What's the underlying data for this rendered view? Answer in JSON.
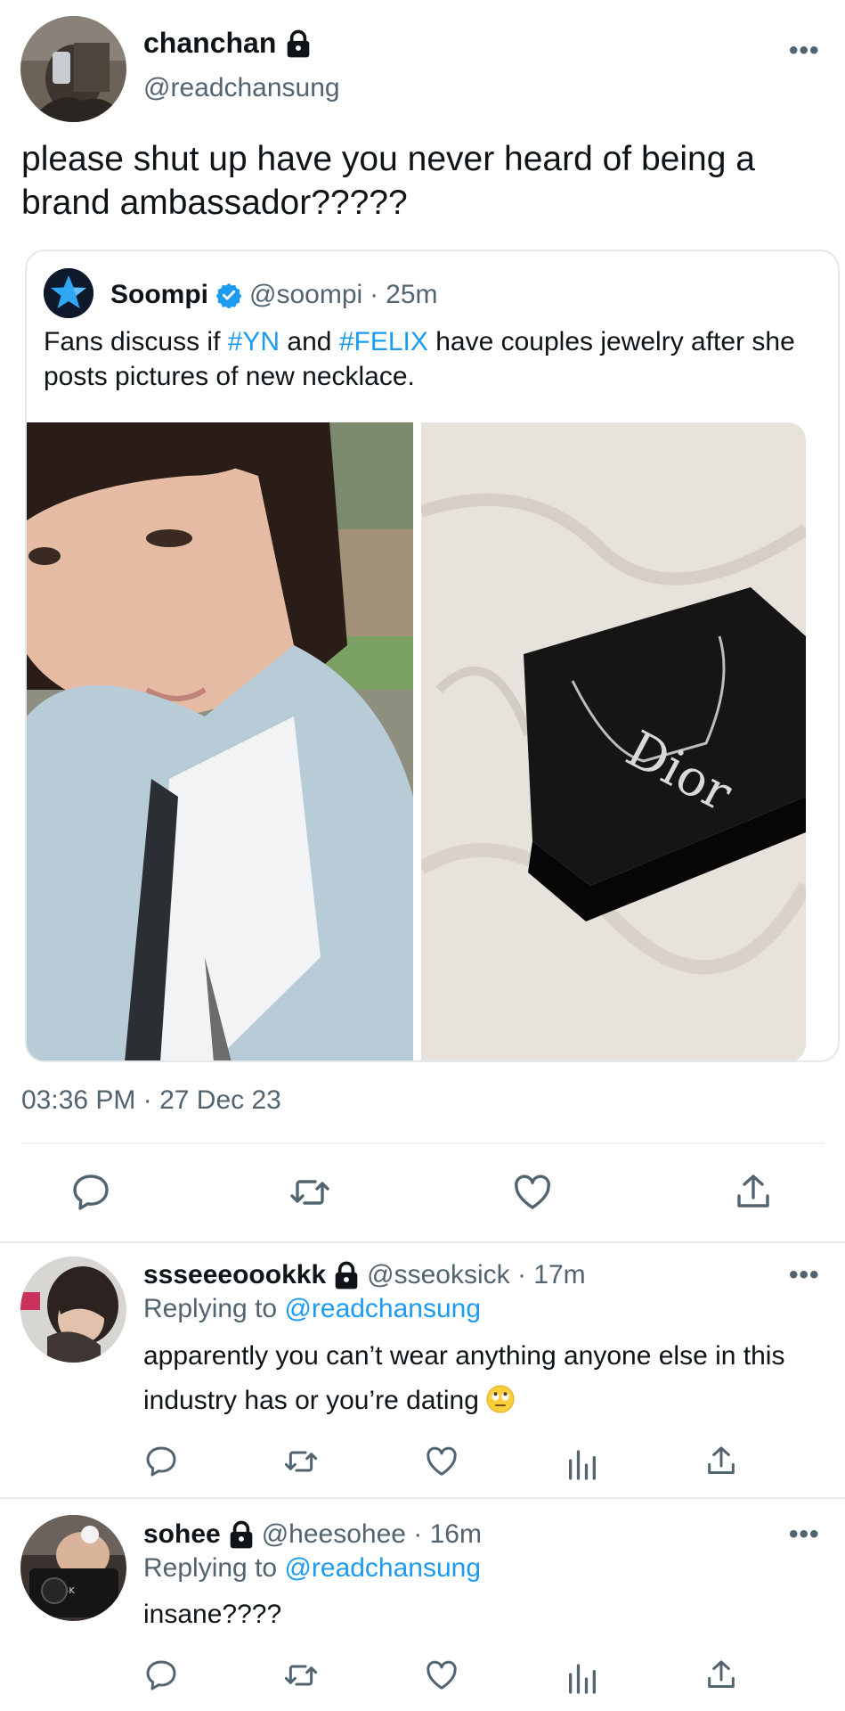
{
  "main_tweet": {
    "author_name": "chanchan",
    "author_handle": "@readchansung",
    "text": "please shut up have you never heard of being a brand ambassador?????",
    "timestamp": "03:36 PM · 27 Dec 23",
    "more_label": "•••"
  },
  "quoted_tweet": {
    "author_name": "Soompi",
    "author_handle": "@soompi",
    "separator": "·",
    "time_ago": "25m",
    "text_part1": "Fans discuss if ",
    "hashtag1": "#YN",
    "text_part2": " and ",
    "hashtag2": "#FELIX",
    "text_part3": " have couples jewelry after she posts pictures of new necklace."
  },
  "replies": [
    {
      "author_name": "ssseeeoookkk",
      "meta": "@sseoksick · 17m",
      "replying_prefix": "Replying to ",
      "replying_handle": "@readchansung",
      "text": "apparently you can’t wear anything anyone else in this industry has or you’re dating",
      "emoji": "face-with-rolling-eyes",
      "more_label": "•••"
    },
    {
      "author_name": "sohee",
      "meta": "@heesohee · 16m",
      "replying_prefix": "Replying to ",
      "replying_handle": "@readchansung",
      "text": "insane????",
      "more_label": "•••"
    }
  ],
  "icons": {
    "reply": "speech-bubble-icon",
    "retweet": "retweet-icon",
    "like": "heart-icon",
    "views": "bar-chart-icon",
    "share": "share-upload-icon",
    "lock": "lock-icon",
    "verified": "verified-badge-icon"
  },
  "colors": {
    "accent": "#1d9bf0",
    "text_primary": "#0f1419",
    "text_secondary": "#536471",
    "divider": "#eff3f4"
  }
}
